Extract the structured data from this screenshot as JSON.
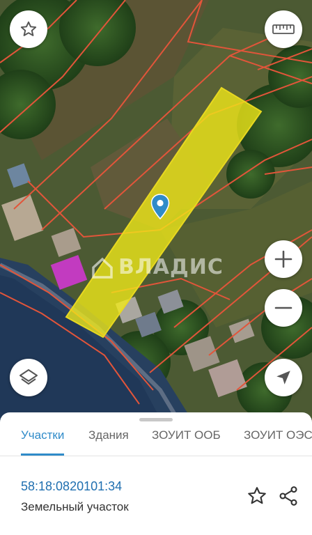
{
  "map": {
    "watermark_text": "ВЛАДИС",
    "colors": {
      "parcel_fill": "#f2ea18",
      "parcel_border": "#e8d820",
      "cadastral_lines": "#e2553a",
      "pin": "#2f8bc9"
    }
  },
  "controls": {
    "favorite_icon": "star-outline-icon",
    "ruler_icon": "ruler-icon",
    "zoom_in_icon": "plus-icon",
    "zoom_out_icon": "minus-icon",
    "layers_icon": "layers-icon",
    "location_icon": "navigation-arrow-icon"
  },
  "sheet": {
    "tabs": [
      {
        "label": "Участки",
        "active": true
      },
      {
        "label": "Здания",
        "active": false
      },
      {
        "label": "ЗОУИТ ООБ",
        "active": false
      },
      {
        "label": "ЗОУИТ ОЭС",
        "active": false
      }
    ],
    "parcel": {
      "cadastral_number": "58:18:0820101:34",
      "type": "Земельный участок"
    },
    "accent_color": "#2f8bc9"
  }
}
